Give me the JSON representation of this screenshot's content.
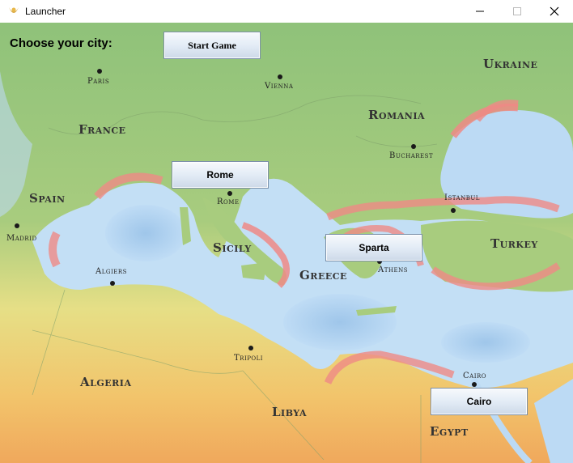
{
  "window": {
    "title": "Launcher"
  },
  "heading": "Choose your city:",
  "buttons": {
    "start": "Start Game",
    "rome": "Rome",
    "sparta": "Sparta",
    "cairo": "Cairo"
  },
  "countries": [
    "Ukraine",
    "Romania",
    "France",
    "Spain",
    "Turkey",
    "Greece",
    "Sicily",
    "Algeria",
    "Libya",
    "Egypt"
  ],
  "cities": [
    "Paris",
    "Vienna",
    "Bucharest",
    "Istanbul",
    "Rome",
    "Madrid",
    "Algiers",
    "Athens",
    "Tripoli",
    "Cairo"
  ]
}
